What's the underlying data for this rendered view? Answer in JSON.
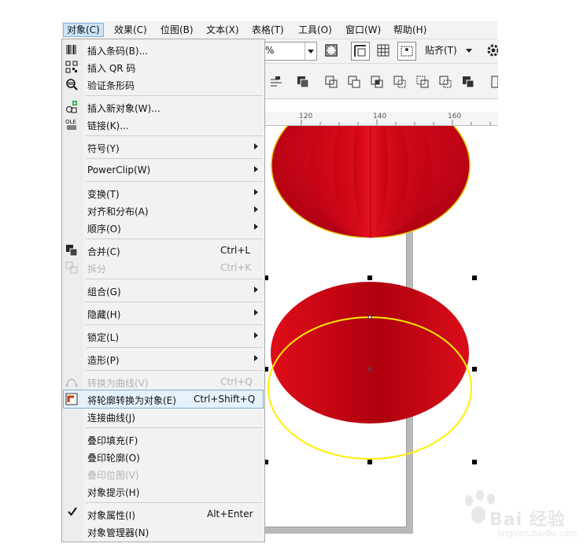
{
  "menubar": {
    "items": [
      {
        "label": "对象(C)",
        "active": true
      },
      {
        "label": "效果(C)"
      },
      {
        "label": "位图(B)"
      },
      {
        "label": "文本(X)"
      },
      {
        "label": "表格(T)"
      },
      {
        "label": "工具(O)"
      },
      {
        "label": "窗口(W)"
      },
      {
        "label": "帮助(H)"
      }
    ]
  },
  "toolbar": {
    "zoom_value": "%",
    "snap_label": "贴齐(T)"
  },
  "ruler": {
    "labels": [
      "120",
      "140",
      "160"
    ]
  },
  "menu": {
    "items": [
      {
        "label": "插入条码(B)...",
        "icon": "barcode-icon"
      },
      {
        "label": "插入 QR 码",
        "icon": "qr-code-icon"
      },
      {
        "label": "验证条形码",
        "icon": "verify-barcode-icon"
      },
      {
        "label": "插入新对象(W)...",
        "icon": "insert-object-icon"
      },
      {
        "label": "链接(K)...",
        "icon": "ole-link-icon"
      },
      {
        "label": "符号(Y)"
      },
      {
        "label": "PowerClip(W)"
      },
      {
        "label": "变换(T)"
      },
      {
        "label": "对齐和分布(A)"
      },
      {
        "label": "顺序(O)"
      },
      {
        "label": "合并(C)",
        "shortcut": "Ctrl+L",
        "icon": "combine-icon"
      },
      {
        "label": "拆分",
        "shortcut": "Ctrl+K",
        "icon": "break-apart-icon",
        "disabled": true
      },
      {
        "label": "组合(G)"
      },
      {
        "label": "隐藏(H)"
      },
      {
        "label": "锁定(L)"
      },
      {
        "label": "造形(P)"
      },
      {
        "label": "转换为曲线(V)",
        "shortcut": "Ctrl+Q",
        "icon": "convert-curves-icon",
        "disabled": true
      },
      {
        "label": "将轮廓转换为对象(E)",
        "shortcut": "Ctrl+Shift+Q",
        "icon": "outline-to-object-icon",
        "highlighted": true
      },
      {
        "label": "连接曲线(J)"
      },
      {
        "label": "叠印填充(F)"
      },
      {
        "label": "叠印轮廓(O)"
      },
      {
        "label": "叠印位图(V)",
        "disabled": true
      },
      {
        "label": "对象提示(H)"
      },
      {
        "label": "对象属性(I)",
        "shortcut": "Alt+Enter",
        "checked": true
      },
      {
        "label": "对象管理器(N)"
      }
    ]
  },
  "colors": {
    "lantern_red_light": "#e0101c",
    "lantern_red_dark": "#a80010",
    "outline_yellow": "#ffee00",
    "menu_highlight": "#e5f1fb",
    "menu_highlight_border": "#77aee0"
  },
  "watermark": {
    "brand": "Bai 经验",
    "sub": "jingyan.baidu.com"
  }
}
